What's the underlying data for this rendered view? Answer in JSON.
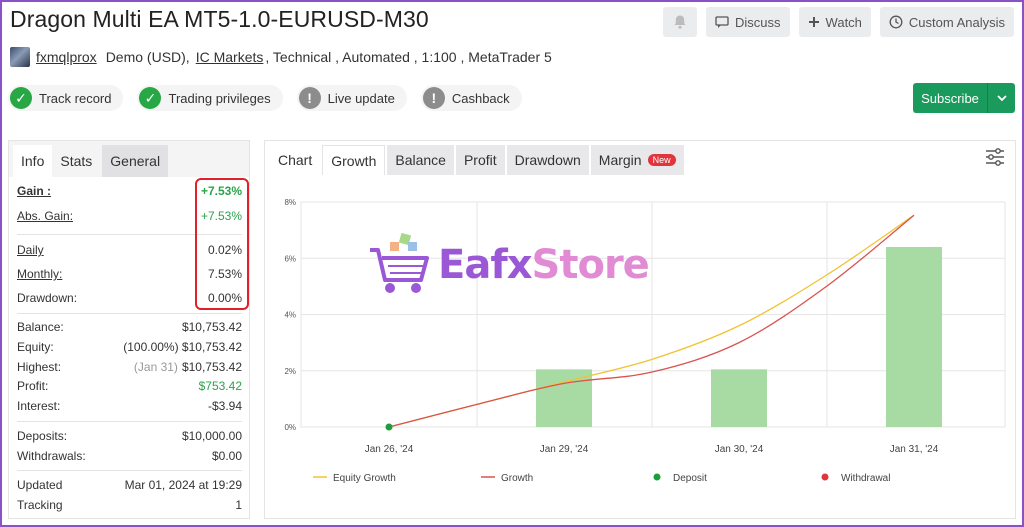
{
  "header": {
    "title": "Dragon Multi EA MT5-1.0-EURUSD-M30",
    "actions": {
      "discuss": "Discuss",
      "watch": "Watch",
      "custom_analysis": "Custom Analysis"
    }
  },
  "account": {
    "user": "fxmqlprox",
    "type": "Demo (USD),",
    "broker": "IC Markets",
    "rest": ", Technical , Automated , 1:100 , MetaTrader 5"
  },
  "badges": [
    {
      "label": "Track record",
      "status": "ok"
    },
    {
      "label": "Trading privileges",
      "status": "ok"
    },
    {
      "label": "Live update",
      "status": "warn"
    },
    {
      "label": "Cashback",
      "status": "warn"
    }
  ],
  "subscribe_label": "Subscribe",
  "left_tabs": [
    "Info",
    "Stats",
    "General"
  ],
  "stats": {
    "gain": {
      "label": "Gain :",
      "value": "+7.53%"
    },
    "abs_gain": {
      "label": "Abs. Gain:",
      "value": "+7.53%"
    },
    "daily": {
      "label": "Daily",
      "value": "0.02%"
    },
    "monthly": {
      "label": "Monthly:",
      "value": "7.53%"
    },
    "drawdown": {
      "label": "Drawdown:",
      "value": "0.00%"
    },
    "balance": {
      "label": "Balance:",
      "value": "$10,753.42"
    },
    "equity": {
      "label": "Equity:",
      "value": "(100.00%) $10,753.42"
    },
    "highest": {
      "label": "Highest:",
      "note": "(Jan 31)",
      "value": "$10,753.42"
    },
    "profit": {
      "label": "Profit:",
      "value": "$753.42"
    },
    "interest": {
      "label": "Interest:",
      "value": "-$3.94"
    },
    "deposits": {
      "label": "Deposits:",
      "value": "$10,000.00"
    },
    "withdrawals": {
      "label": "Withdrawals:",
      "value": "$0.00"
    },
    "updated": {
      "label": "Updated",
      "value": "Mar 01, 2024 at 19:29"
    },
    "tracking": {
      "label": "Tracking",
      "value": "1"
    }
  },
  "chart_tabs": {
    "chart": "Chart",
    "growth": "Growth",
    "balance": "Balance",
    "profit": "Profit",
    "drawdown": "Drawdown",
    "margin": "Margin",
    "new_tag": "New"
  },
  "watermark": {
    "part1": "Eafx",
    "part2": "Store"
  },
  "chart_data": {
    "type": "bar",
    "categories": [
      "Jan 26, '24",
      "Jan 29, '24",
      "Jan 30, '24",
      "Jan 31, '24"
    ],
    "y_ticks": [
      "0%",
      "2%",
      "4%",
      "6%",
      "8%"
    ],
    "ylim": [
      0,
      8
    ],
    "grid": true,
    "bars": {
      "values": [
        0,
        2.05,
        2.05,
        6.4
      ],
      "color": "#a8dba3"
    },
    "series": [
      {
        "name": "Equity Growth",
        "color": "#f2c232",
        "x": [
          0,
          0.5,
          1,
          1.5,
          2,
          2.5,
          3
        ],
        "values": [
          0,
          0.8,
          1.6,
          2.4,
          3.6,
          5.4,
          7.53
        ]
      },
      {
        "name": "Growth",
        "color": "#d9534f",
        "x": [
          0,
          0.5,
          1,
          1.5,
          2,
          2.5,
          3
        ],
        "values": [
          0,
          0.8,
          1.55,
          1.95,
          3.0,
          5.0,
          7.53
        ]
      }
    ],
    "deposit": {
      "name": "Deposit",
      "x": 0,
      "value": 0,
      "color": "#1e9e3a"
    },
    "withdrawal": {
      "name": "Withdrawal",
      "color": "#e0353d"
    },
    "legend_position": "bottom"
  }
}
